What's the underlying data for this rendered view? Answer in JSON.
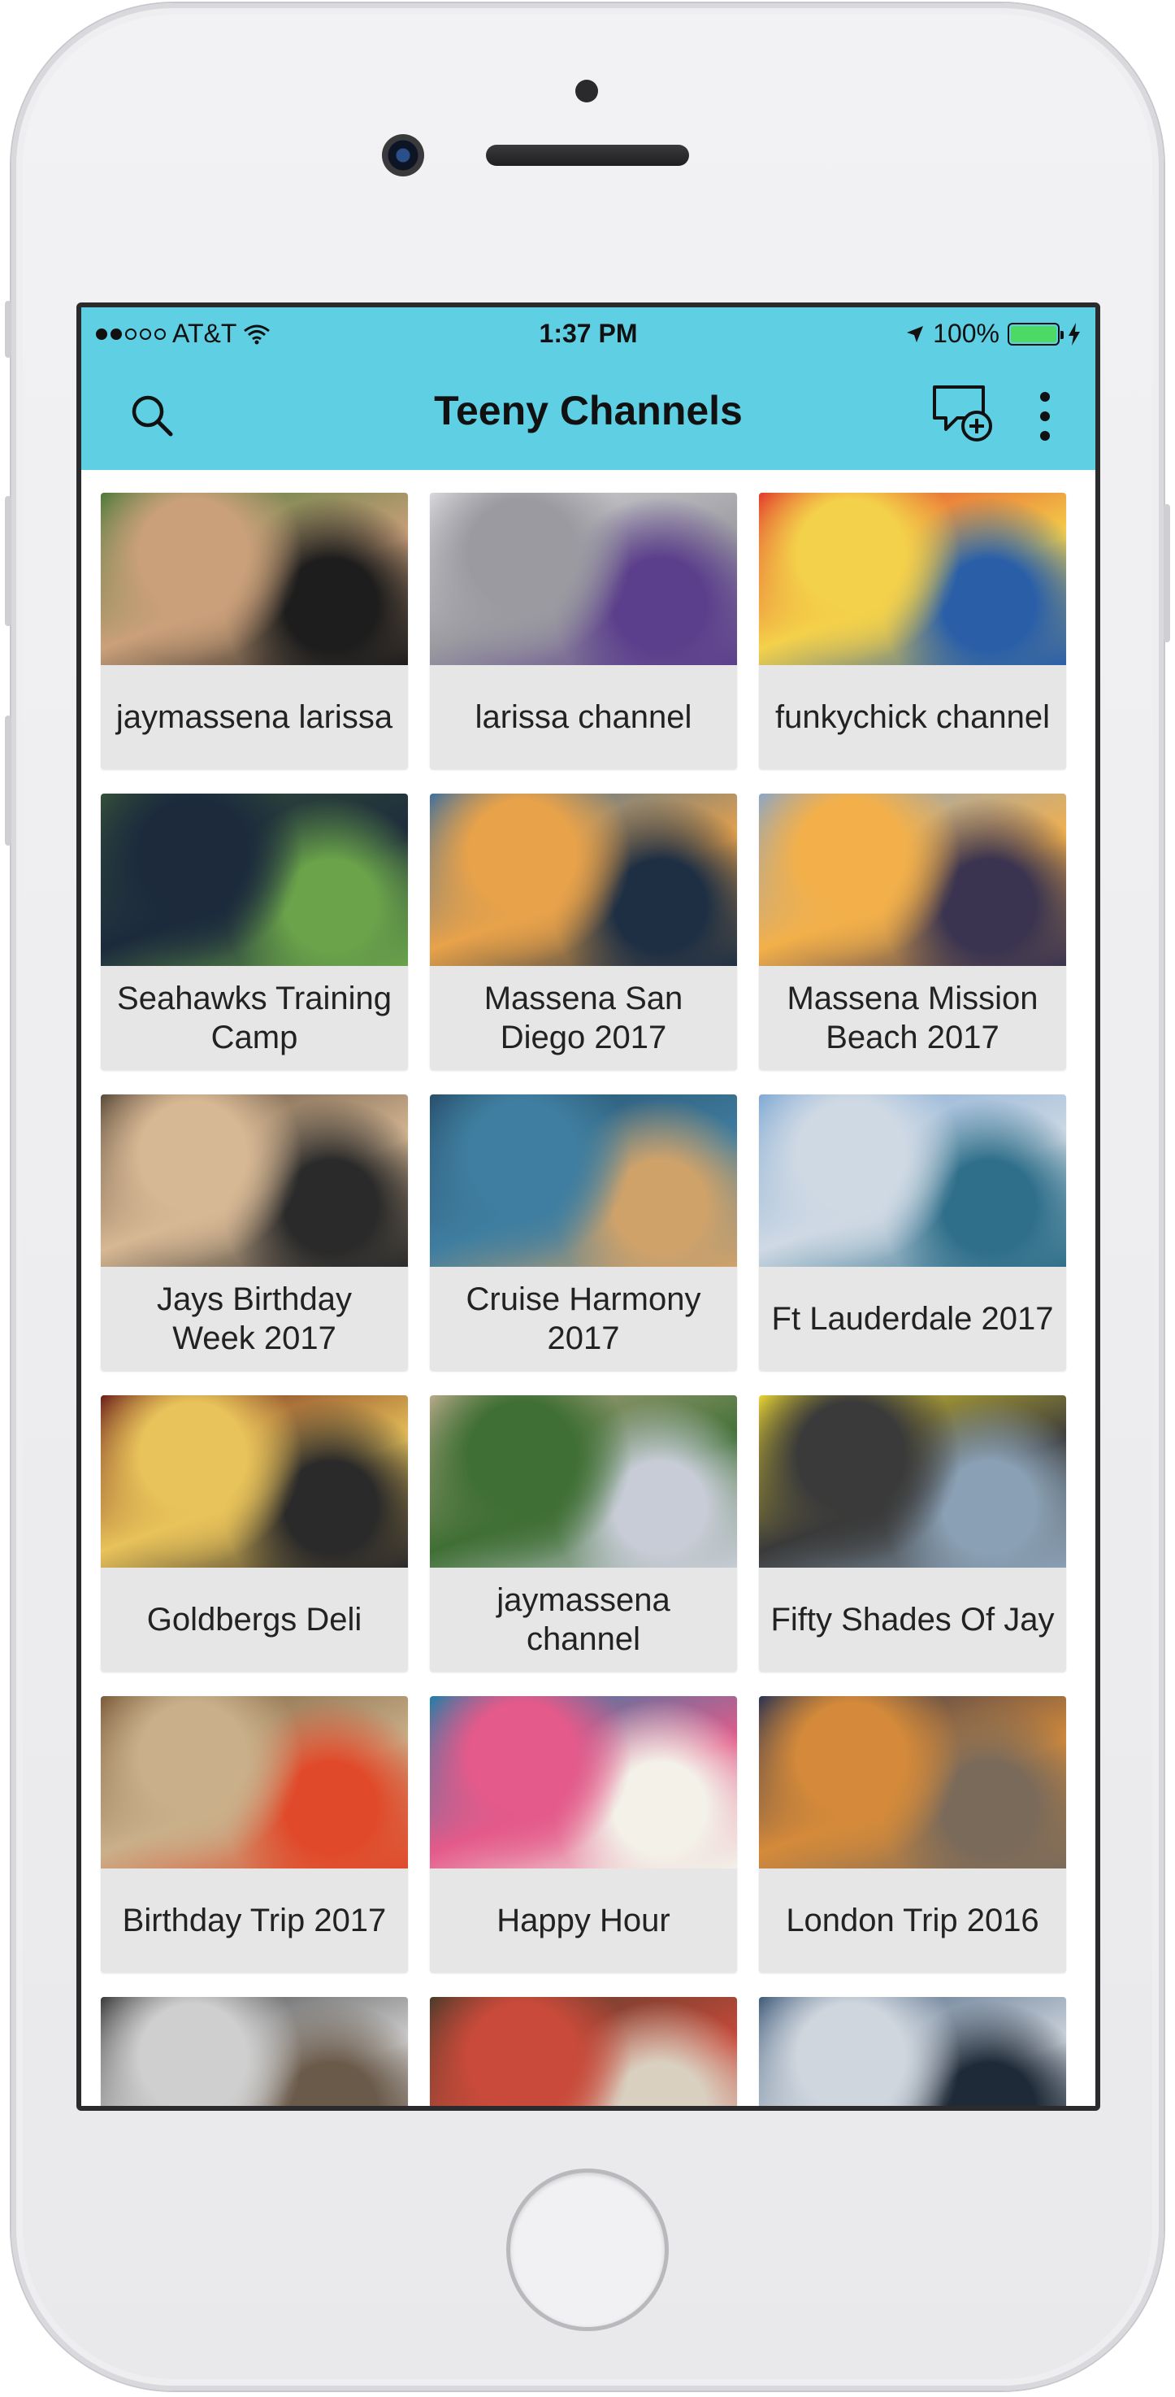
{
  "status_bar": {
    "carrier": "AT&T",
    "time": "1:37 PM",
    "battery": "100%"
  },
  "header": {
    "title": "Teeny Channels",
    "icons": [
      "search-icon",
      "new-channel-icon",
      "more-vertical-icon"
    ],
    "accent_color": "#5fd0e4"
  },
  "channels": [
    {
      "label": "jaymassena larissa",
      "thumb": [
        "#4d7a3a",
        "#caa07a",
        "#1d1d1d"
      ]
    },
    {
      "label": "larissa channel",
      "thumb": [
        "#d9d9dc",
        "#9a9aa0",
        "#5c3f8c"
      ]
    },
    {
      "label": "funkychick channel",
      "thumb": [
        "#e23a2d",
        "#f4d14a",
        "#2a5fa8"
      ]
    },
    {
      "label": "Seahawks Training Camp",
      "thumb": [
        "#34503a",
        "#1c2a3c",
        "#6aa34a"
      ]
    },
    {
      "label": "Massena San Diego 2017",
      "thumb": [
        "#3e6f9c",
        "#e8a24a",
        "#1e2f44"
      ]
    },
    {
      "label": "Massena Mission Beach 2017",
      "thumb": [
        "#8aa6c8",
        "#f3b04a",
        "#3a3450"
      ]
    },
    {
      "label": "Jays Birthday Week 2017",
      "thumb": [
        "#5a4a3a",
        "#d7b894",
        "#2a2a2a"
      ]
    },
    {
      "label": "Cruise Harmony 2017",
      "thumb": [
        "#274e6a",
        "#3f7ea0",
        "#cfa26a"
      ]
    },
    {
      "label": "Ft Lauderdale 2017",
      "thumb": [
        "#7fa9d4",
        "#cfd9e4",
        "#2f6f8a"
      ]
    },
    {
      "label": "Goldbergs Deli",
      "thumb": [
        "#6a1f1a",
        "#e8c25a",
        "#2b2a2a"
      ]
    },
    {
      "label": "jaymassena channel",
      "thumb": [
        "#b9aa8a",
        "#3f6f34",
        "#c7ccd6"
      ]
    },
    {
      "label": "Fifty Shades Of Jay",
      "thumb": [
        "#e8d433",
        "#3a3a3a",
        "#8aa0b4"
      ]
    },
    {
      "label": "Birthday Trip 2017",
      "thumb": [
        "#7a5a3a",
        "#c9b08a",
        "#e04a2a"
      ]
    },
    {
      "label": "Happy Hour",
      "thumb": [
        "#1d7fa8",
        "#e45a8a",
        "#f3f1e8"
      ]
    },
    {
      "label": "London Trip 2016",
      "thumb": [
        "#2a3250",
        "#d48a3a",
        "#7a6a5a"
      ]
    },
    {
      "label": "",
      "thumb": [
        "#3a3a3a",
        "#cfcfcf",
        "#6a5a4a"
      ]
    },
    {
      "label": "",
      "thumb": [
        "#4a3a2a",
        "#c94a3a",
        "#d9d0c0"
      ]
    },
    {
      "label": "",
      "thumb": [
        "#3f5a78",
        "#cfd6de",
        "#1f2a38"
      ]
    }
  ]
}
